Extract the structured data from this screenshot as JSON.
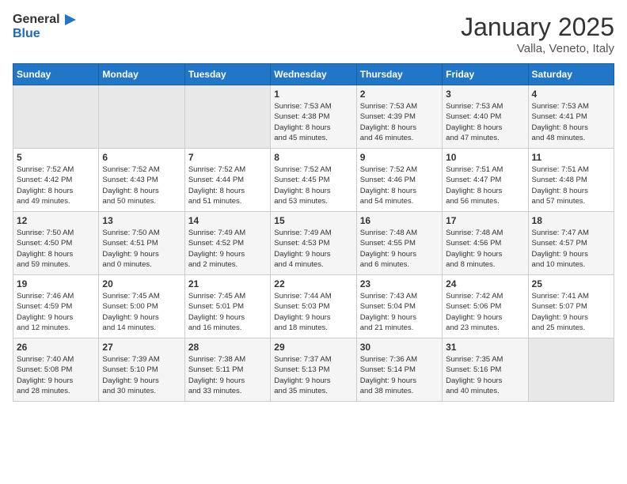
{
  "logo": {
    "text_general": "General",
    "text_blue": "Blue"
  },
  "title": {
    "month": "January 2025",
    "location": "Valla, Veneto, Italy"
  },
  "weekdays": [
    "Sunday",
    "Monday",
    "Tuesday",
    "Wednesday",
    "Thursday",
    "Friday",
    "Saturday"
  ],
  "weeks": [
    [
      {
        "day": "",
        "info": ""
      },
      {
        "day": "",
        "info": ""
      },
      {
        "day": "",
        "info": ""
      },
      {
        "day": "1",
        "info": "Sunrise: 7:53 AM\nSunset: 4:38 PM\nDaylight: 8 hours\nand 45 minutes."
      },
      {
        "day": "2",
        "info": "Sunrise: 7:53 AM\nSunset: 4:39 PM\nDaylight: 8 hours\nand 46 minutes."
      },
      {
        "day": "3",
        "info": "Sunrise: 7:53 AM\nSunset: 4:40 PM\nDaylight: 8 hours\nand 47 minutes."
      },
      {
        "day": "4",
        "info": "Sunrise: 7:53 AM\nSunset: 4:41 PM\nDaylight: 8 hours\nand 48 minutes."
      }
    ],
    [
      {
        "day": "5",
        "info": "Sunrise: 7:52 AM\nSunset: 4:42 PM\nDaylight: 8 hours\nand 49 minutes."
      },
      {
        "day": "6",
        "info": "Sunrise: 7:52 AM\nSunset: 4:43 PM\nDaylight: 8 hours\nand 50 minutes."
      },
      {
        "day": "7",
        "info": "Sunrise: 7:52 AM\nSunset: 4:44 PM\nDaylight: 8 hours\nand 51 minutes."
      },
      {
        "day": "8",
        "info": "Sunrise: 7:52 AM\nSunset: 4:45 PM\nDaylight: 8 hours\nand 53 minutes."
      },
      {
        "day": "9",
        "info": "Sunrise: 7:52 AM\nSunset: 4:46 PM\nDaylight: 8 hours\nand 54 minutes."
      },
      {
        "day": "10",
        "info": "Sunrise: 7:51 AM\nSunset: 4:47 PM\nDaylight: 8 hours\nand 56 minutes."
      },
      {
        "day": "11",
        "info": "Sunrise: 7:51 AM\nSunset: 4:48 PM\nDaylight: 8 hours\nand 57 minutes."
      }
    ],
    [
      {
        "day": "12",
        "info": "Sunrise: 7:50 AM\nSunset: 4:50 PM\nDaylight: 8 hours\nand 59 minutes."
      },
      {
        "day": "13",
        "info": "Sunrise: 7:50 AM\nSunset: 4:51 PM\nDaylight: 9 hours\nand 0 minutes."
      },
      {
        "day": "14",
        "info": "Sunrise: 7:49 AM\nSunset: 4:52 PM\nDaylight: 9 hours\nand 2 minutes."
      },
      {
        "day": "15",
        "info": "Sunrise: 7:49 AM\nSunset: 4:53 PM\nDaylight: 9 hours\nand 4 minutes."
      },
      {
        "day": "16",
        "info": "Sunrise: 7:48 AM\nSunset: 4:55 PM\nDaylight: 9 hours\nand 6 minutes."
      },
      {
        "day": "17",
        "info": "Sunrise: 7:48 AM\nSunset: 4:56 PM\nDaylight: 9 hours\nand 8 minutes."
      },
      {
        "day": "18",
        "info": "Sunrise: 7:47 AM\nSunset: 4:57 PM\nDaylight: 9 hours\nand 10 minutes."
      }
    ],
    [
      {
        "day": "19",
        "info": "Sunrise: 7:46 AM\nSunset: 4:59 PM\nDaylight: 9 hours\nand 12 minutes."
      },
      {
        "day": "20",
        "info": "Sunrise: 7:45 AM\nSunset: 5:00 PM\nDaylight: 9 hours\nand 14 minutes."
      },
      {
        "day": "21",
        "info": "Sunrise: 7:45 AM\nSunset: 5:01 PM\nDaylight: 9 hours\nand 16 minutes."
      },
      {
        "day": "22",
        "info": "Sunrise: 7:44 AM\nSunset: 5:03 PM\nDaylight: 9 hours\nand 18 minutes."
      },
      {
        "day": "23",
        "info": "Sunrise: 7:43 AM\nSunset: 5:04 PM\nDaylight: 9 hours\nand 21 minutes."
      },
      {
        "day": "24",
        "info": "Sunrise: 7:42 AM\nSunset: 5:06 PM\nDaylight: 9 hours\nand 23 minutes."
      },
      {
        "day": "25",
        "info": "Sunrise: 7:41 AM\nSunset: 5:07 PM\nDaylight: 9 hours\nand 25 minutes."
      }
    ],
    [
      {
        "day": "26",
        "info": "Sunrise: 7:40 AM\nSunset: 5:08 PM\nDaylight: 9 hours\nand 28 minutes."
      },
      {
        "day": "27",
        "info": "Sunrise: 7:39 AM\nSunset: 5:10 PM\nDaylight: 9 hours\nand 30 minutes."
      },
      {
        "day": "28",
        "info": "Sunrise: 7:38 AM\nSunset: 5:11 PM\nDaylight: 9 hours\nand 33 minutes."
      },
      {
        "day": "29",
        "info": "Sunrise: 7:37 AM\nSunset: 5:13 PM\nDaylight: 9 hours\nand 35 minutes."
      },
      {
        "day": "30",
        "info": "Sunrise: 7:36 AM\nSunset: 5:14 PM\nDaylight: 9 hours\nand 38 minutes."
      },
      {
        "day": "31",
        "info": "Sunrise: 7:35 AM\nSunset: 5:16 PM\nDaylight: 9 hours\nand 40 minutes."
      },
      {
        "day": "",
        "info": ""
      }
    ]
  ]
}
